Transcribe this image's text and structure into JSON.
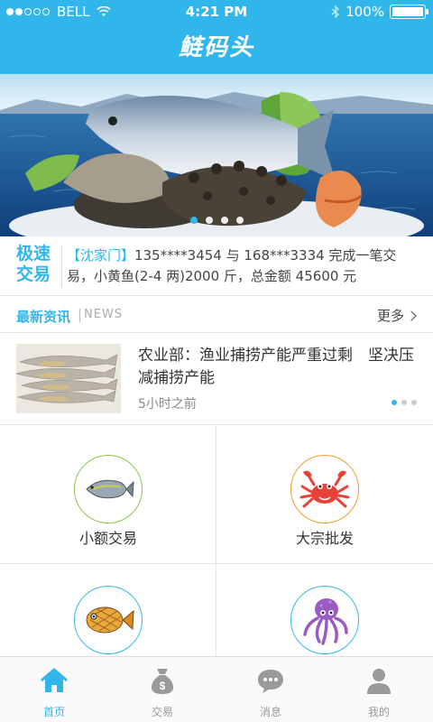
{
  "status": {
    "carrier": "BELL",
    "time": "4:21 PM",
    "battery": "100%"
  },
  "header": {
    "title": "鲢码头"
  },
  "banner": {
    "slides": 4,
    "active_index": 0
  },
  "fast_trade": {
    "tag_line1": "极速",
    "tag_line2": "交易",
    "location": "【沈家门】",
    "text": "135****3454 与 168***3334 完成一笔交易，小黄鱼(2-4 两)2000 斤，总金额 45600 元"
  },
  "news": {
    "title": "最新资讯",
    "subtitle": "NEWS",
    "more": "更多",
    "item": {
      "title": "农业部：渔业捕捞产能严重过剩　坚决压减捕捞产能",
      "time": "5小时之前"
    },
    "pages": 3,
    "active_page": 0
  },
  "features": [
    {
      "label": "小额交易",
      "icon": "fish-icon",
      "ring_color": "#8bc34a"
    },
    {
      "label": "大宗批发",
      "icon": "crab-icon",
      "ring_color": "#f39c2b"
    },
    {
      "label": "",
      "icon": "pufferfish-icon",
      "ring_color": "#30b6ea"
    },
    {
      "label": "",
      "icon": "octopus-icon",
      "ring_color": "#30b6ea"
    }
  ],
  "tabs": [
    {
      "label": "首页",
      "icon": "home-icon",
      "active": true
    },
    {
      "label": "交易",
      "icon": "money-bag-icon",
      "active": false
    },
    {
      "label": "消息",
      "icon": "message-icon",
      "active": false
    },
    {
      "label": "我的",
      "icon": "user-icon",
      "active": false
    }
  ],
  "colors": {
    "accent": "#30b6ea",
    "text": "#333333"
  }
}
